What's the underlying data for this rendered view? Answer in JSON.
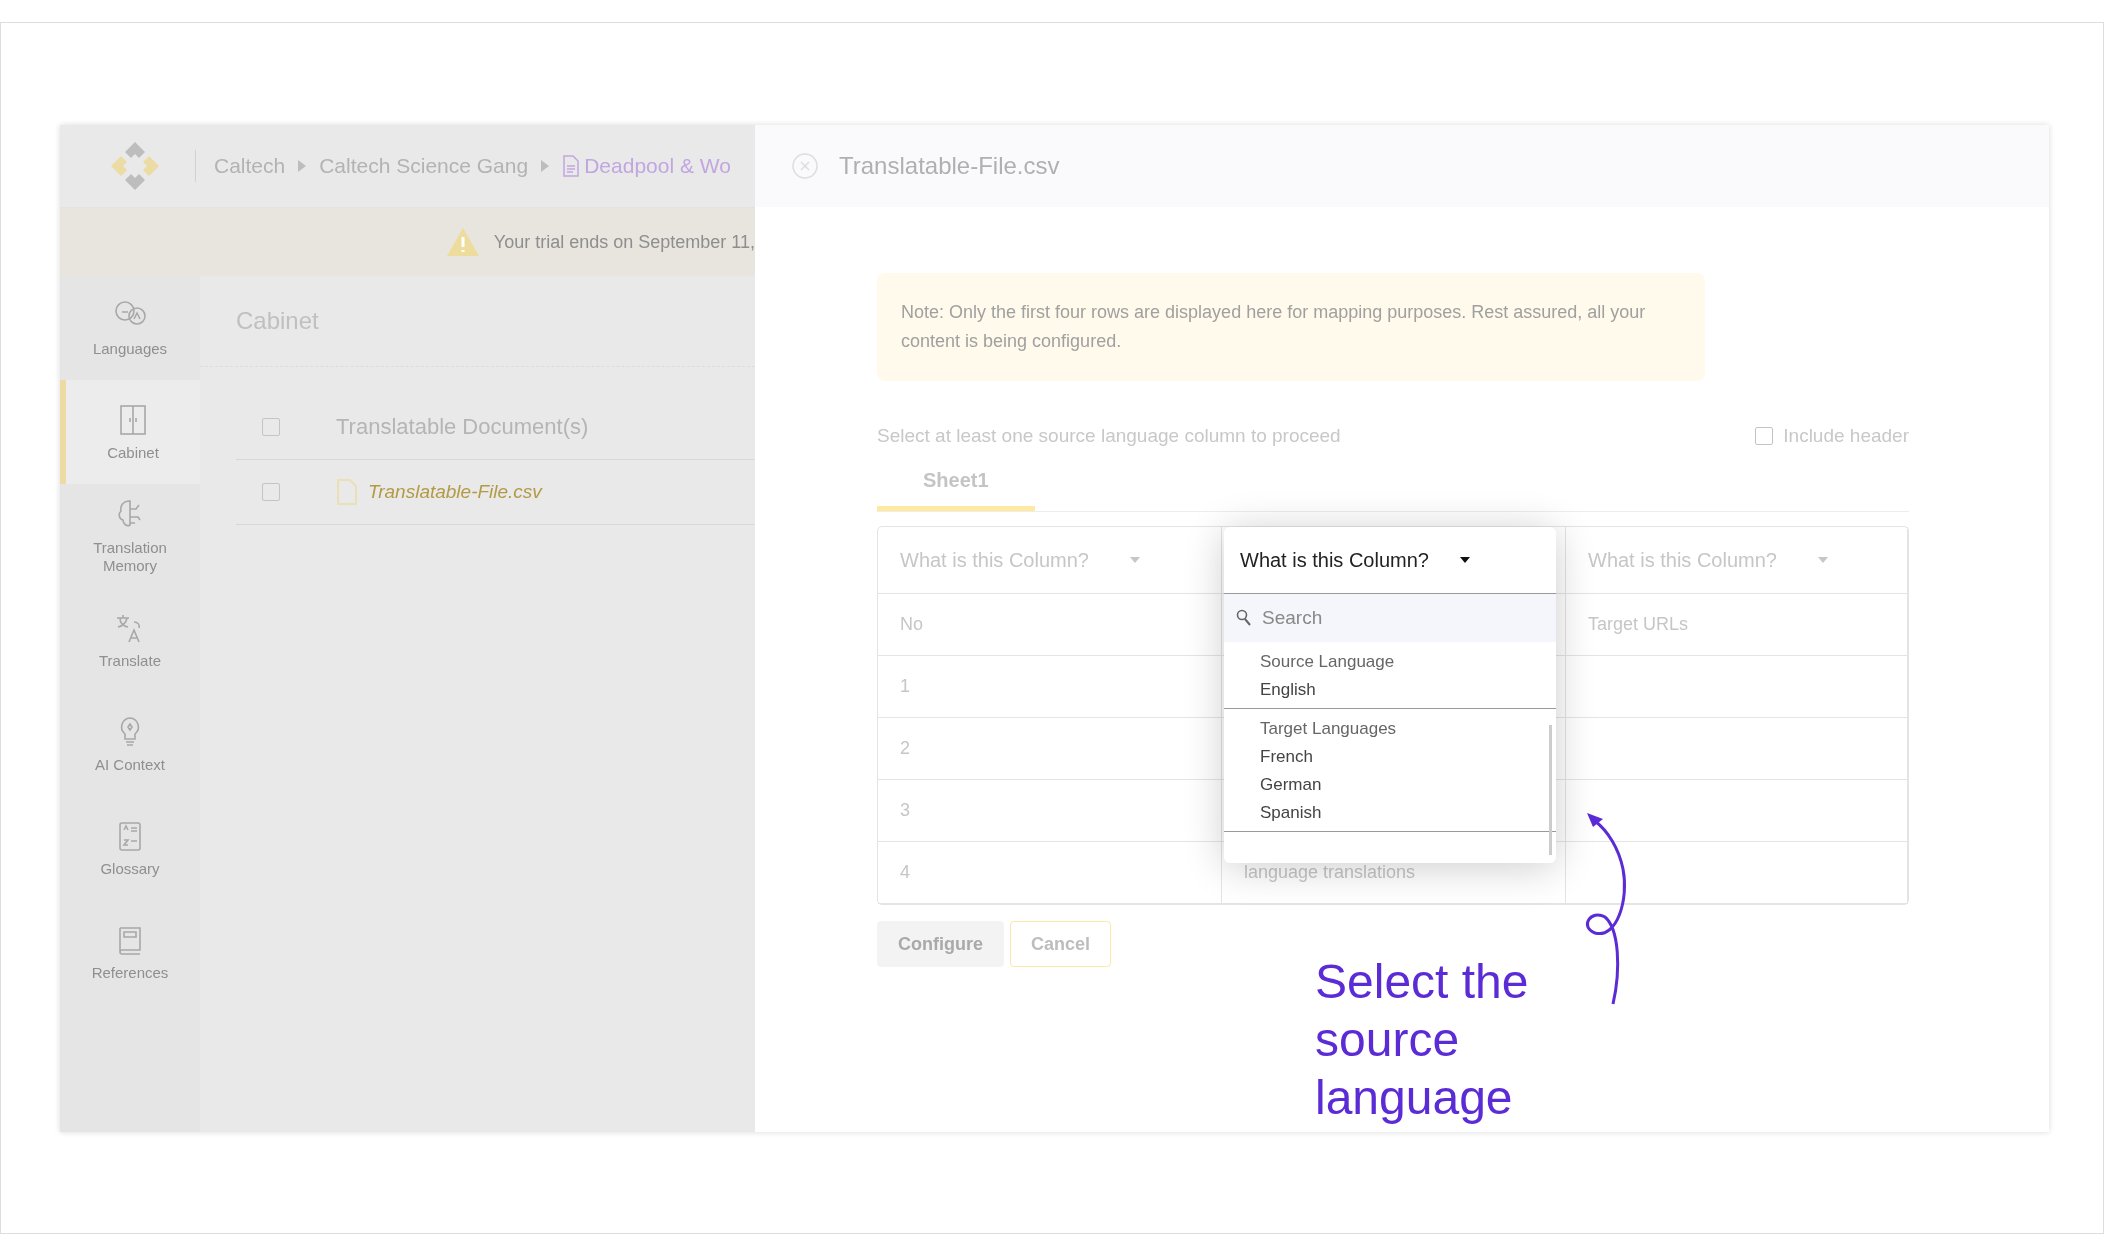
{
  "header": {
    "breadcrumbs": [
      {
        "label": "Caltech",
        "kind": "link"
      },
      {
        "label": "Caltech Science Gang",
        "kind": "link"
      },
      {
        "label": "Deadpool & Wo",
        "kind": "document"
      }
    ]
  },
  "trial_banner": {
    "text": "Your trial ends on September 11,"
  },
  "sidebar": {
    "items": [
      {
        "label": "Languages",
        "selected": false
      },
      {
        "label": "Cabinet",
        "selected": true
      },
      {
        "label": "Translation Memory",
        "selected": false
      },
      {
        "label": "Translate",
        "selected": false
      },
      {
        "label": "AI Context",
        "selected": false
      },
      {
        "label": "Glossary",
        "selected": false
      },
      {
        "label": "References",
        "selected": false
      }
    ]
  },
  "cabinet": {
    "title": "Cabinet",
    "header": {
      "label": "Translatable Document(s)",
      "checked": false
    },
    "files": [
      {
        "name": "Translatable-File.csv",
        "checked": false
      }
    ]
  },
  "dialog": {
    "title": "Translatable-File.csv",
    "note": "Note: Only the first four rows are displayed here for mapping purposes. Rest assured, all your content is being configured.",
    "instruction": "Select at least one source language column to proceed",
    "include_header": {
      "label": "Include header",
      "checked": false
    },
    "tabs": [
      {
        "label": "Sheet1",
        "selected": true
      }
    ],
    "columns": [
      {
        "select": "What is this Column?",
        "open": false
      },
      {
        "select": "What is this Column?",
        "open": true
      },
      {
        "select": "What is this Column?",
        "open": false
      }
    ],
    "rows": [
      {
        "column_1": "No",
        "column_3": "Target URLs"
      },
      {
        "column_1": "1"
      },
      {
        "column_1": "2"
      },
      {
        "column_1": "3"
      },
      {
        "column_1": "4",
        "column_2": "language translations"
      }
    ],
    "dropdown": {
      "placeholder": "Search",
      "groups": [
        {
          "label": "Source Language",
          "options": [
            "English"
          ]
        },
        {
          "label": "Target Languages",
          "options": [
            "French",
            "German",
            "Spanish"
          ]
        }
      ]
    },
    "buttons": [
      {
        "label": "Configure",
        "disabled": true
      },
      {
        "label": "Cancel",
        "disabled": false
      }
    ]
  },
  "annotation": {
    "text": "Select the source language"
  }
}
